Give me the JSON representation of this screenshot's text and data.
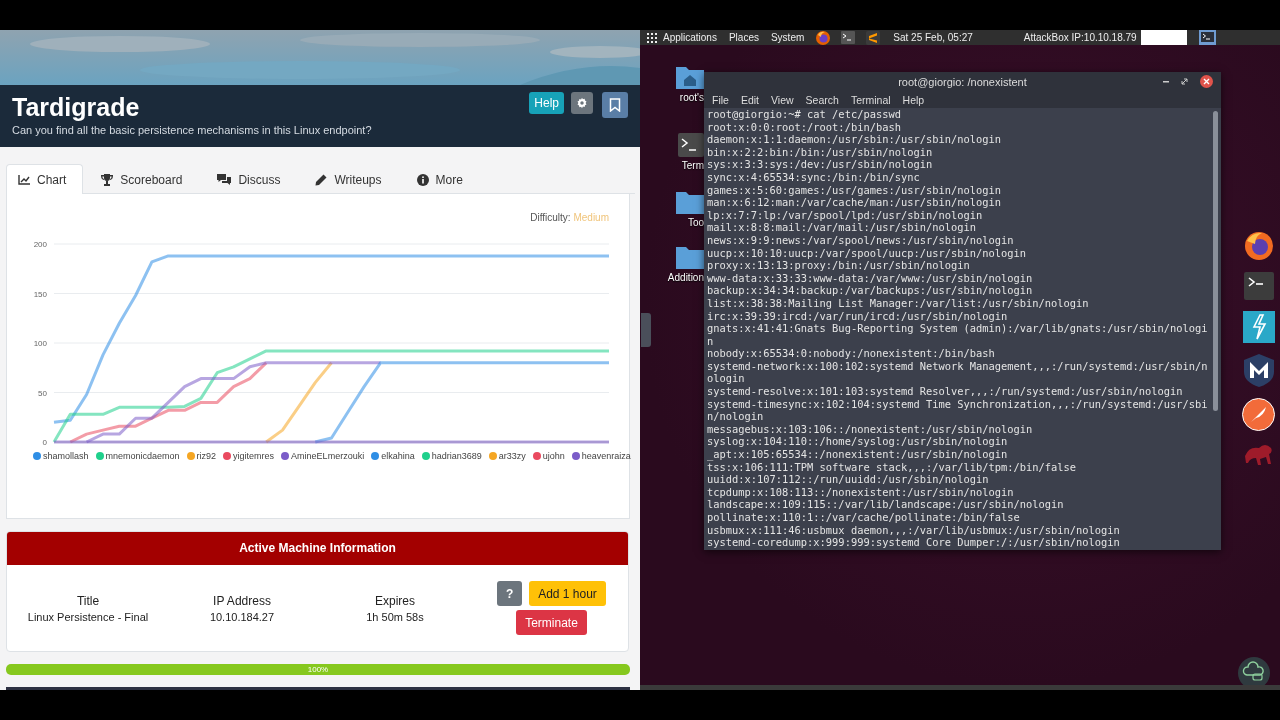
{
  "room": {
    "title": "Tardigrade",
    "description": "Can you find all the basic persistence mechanisms in this Linux endpoint?",
    "buttons": [
      {
        "kind": "help",
        "label": "Help"
      },
      {
        "kind": "settings"
      },
      {
        "kind": "bookmark"
      }
    ]
  },
  "tabs": [
    {
      "label": "Chart",
      "selected": true
    },
    {
      "label": "Scoreboard",
      "selected": false
    },
    {
      "label": "Discuss",
      "selected": false
    },
    {
      "label": "Writeups",
      "selected": false
    },
    {
      "label": "More",
      "selected": false
    }
  ],
  "difficulty": {
    "label": "Difficulty:",
    "value": "Medium"
  },
  "chart_data": {
    "type": "line",
    "grid": true,
    "legend": true,
    "ylim": [
      0,
      200
    ],
    "yticks": [
      0,
      50,
      100,
      150,
      200
    ],
    "series": [
      {
        "name": "shamollash",
        "color": "#2f8ee5",
        "values": [
          20,
          22,
          48,
          88,
          120,
          148,
          182,
          188,
          188,
          188,
          188,
          188,
          188,
          188,
          188,
          188,
          188,
          188,
          188,
          188,
          188,
          188,
          188,
          188,
          188,
          188,
          188,
          188,
          188,
          188,
          188,
          188,
          188,
          188,
          188
        ]
      },
      {
        "name": "mnemonicdaemon",
        "color": "#1fd08c",
        "values": [
          0,
          28,
          28,
          28,
          35,
          35,
          35,
          35,
          36,
          44,
          70,
          76,
          84,
          92,
          92,
          92,
          92,
          92,
          92,
          92,
          92,
          92,
          92,
          92,
          92,
          92,
          92,
          92,
          92,
          92,
          92,
          92,
          92,
          92,
          92
        ]
      },
      {
        "name": "riz92",
        "color": "#f5a623",
        "values": [
          null,
          null,
          null,
          null,
          null,
          null,
          null,
          null,
          null,
          null,
          null,
          null,
          null,
          0,
          12,
          36,
          60,
          80,
          null,
          null,
          null,
          null,
          null,
          null,
          null,
          null,
          null,
          null,
          null,
          null,
          null,
          null,
          null,
          null,
          null
        ]
      },
      {
        "name": "yigitemres",
        "color": "#ea4a5f",
        "values": [
          null,
          0,
          8,
          12,
          16,
          16,
          24,
          32,
          32,
          40,
          40,
          56,
          64,
          80,
          null,
          null,
          null,
          null,
          null,
          null,
          null,
          null,
          null,
          null,
          null,
          null,
          null,
          null,
          null,
          null,
          null,
          null,
          null,
          null,
          null
        ]
      },
      {
        "name": "AmineELmerzouki",
        "color": "#7b5cc8",
        "values": [
          null,
          null,
          0,
          8,
          8,
          24,
          24,
          40,
          56,
          64,
          64,
          64,
          76,
          80,
          80,
          80,
          80,
          80,
          80,
          80,
          80,
          null,
          null,
          null,
          null,
          null,
          null,
          null,
          null,
          null,
          null,
          null,
          null,
          null,
          null
        ]
      },
      {
        "name": "elkahina",
        "color": "#2f8ee5",
        "values": [
          null,
          null,
          null,
          null,
          null,
          null,
          null,
          null,
          null,
          null,
          null,
          null,
          null,
          null,
          null,
          null,
          0,
          4,
          30,
          56,
          80,
          80,
          80,
          80,
          80,
          80,
          80,
          80,
          80,
          80,
          80,
          80,
          80,
          80,
          80
        ]
      },
      {
        "name": "hadrian3689",
        "color": "#1fd08c",
        "values": [
          null,
          null,
          null,
          null,
          null,
          null,
          null,
          null,
          null,
          null,
          null,
          null,
          null,
          null,
          null,
          null,
          null,
          null,
          null,
          null,
          null,
          null,
          null,
          null,
          null,
          null,
          null,
          null,
          null,
          null,
          null,
          null,
          null,
          null,
          null
        ]
      },
      {
        "name": "ar33zy",
        "color": "#f5a623",
        "values": [
          null,
          null,
          null,
          null,
          null,
          null,
          null,
          null,
          null,
          null,
          null,
          null,
          null,
          null,
          null,
          null,
          null,
          null,
          null,
          null,
          null,
          null,
          null,
          null,
          null,
          null,
          null,
          null,
          null,
          null,
          null,
          null,
          null,
          null,
          null
        ]
      },
      {
        "name": "ujohn",
        "color": "#ea4a5f",
        "values": [
          null,
          null,
          null,
          null,
          null,
          null,
          null,
          null,
          null,
          null,
          null,
          null,
          null,
          null,
          null,
          null,
          null,
          null,
          null,
          null,
          null,
          null,
          null,
          null,
          null,
          null,
          null,
          null,
          null,
          null,
          null,
          null,
          null,
          null,
          null
        ]
      },
      {
        "name": "heavenraiza",
        "color": "#7b5cc8",
        "values": [
          0,
          0,
          0,
          0,
          0,
          0,
          0,
          0,
          0,
          0,
          0,
          0,
          0,
          0,
          0,
          0,
          0,
          0,
          0,
          0,
          0,
          0,
          0,
          0,
          0,
          0,
          0,
          0,
          0,
          0,
          0,
          0,
          0,
          0,
          0
        ]
      }
    ]
  },
  "machine": {
    "heading": "Active Machine Information",
    "fields": [
      {
        "label": "Title",
        "value": "Linux Persistence - Final"
      },
      {
        "label": "IP Address",
        "value": "10.10.184.27"
      },
      {
        "label": "Expires",
        "value": "1h 50m 58s"
      }
    ],
    "buttons": [
      {
        "kind": "help",
        "label": "?"
      },
      {
        "kind": "add",
        "label": "Add 1 hour"
      },
      {
        "kind": "terminate",
        "label": "Terminate"
      }
    ]
  },
  "progress": {
    "level": 1,
    "reading": "100%"
  },
  "panel": {
    "menus": [
      "Applications",
      "Places",
      "System"
    ],
    "clock": "Sat 25 Feb, 05:27",
    "address": "AttackBox IP:10.10.18.79"
  },
  "desktop_icons": [
    {
      "kind": "home",
      "label": "root's"
    },
    {
      "kind": "terminal",
      "label": "Term"
    },
    {
      "kind": "folder",
      "label": "Too"
    },
    {
      "kind": "folder",
      "label": "Addition"
    }
  ],
  "terminal": {
    "title": "root@giorgio: /nonexistent",
    "menu": [
      "File",
      "Edit",
      "View",
      "Search",
      "Terminal",
      "Help"
    ],
    "lines": [
      "root@giorgio:~# cat /etc/passwd",
      "root:x:0:0:root:/root:/bin/bash",
      "daemon:x:1:1:daemon:/usr/sbin:/usr/sbin/nologin",
      "bin:x:2:2:bin:/bin:/usr/sbin/nologin",
      "sys:x:3:3:sys:/dev:/usr/sbin/nologin",
      "sync:x:4:65534:sync:/bin:/bin/sync",
      "games:x:5:60:games:/usr/games:/usr/sbin/nologin",
      "man:x:6:12:man:/var/cache/man:/usr/sbin/nologin",
      "lp:x:7:7:lp:/var/spool/lpd:/usr/sbin/nologin",
      "mail:x:8:8:mail:/var/mail:/usr/sbin/nologin",
      "news:x:9:9:news:/var/spool/news:/usr/sbin/nologin",
      "uucp:x:10:10:uucp:/var/spool/uucp:/usr/sbin/nologin",
      "proxy:x:13:13:proxy:/bin:/usr/sbin/nologin",
      "www-data:x:33:33:www-data:/var/www:/usr/sbin/nologin",
      "backup:x:34:34:backup:/var/backups:/usr/sbin/nologin",
      "list:x:38:38:Mailing List Manager:/var/list:/usr/sbin/nologin",
      "irc:x:39:39:ircd:/var/run/ircd:/usr/sbin/nologin",
      "gnats:x:41:41:Gnats Bug-Reporting System (admin):/var/lib/gnats:/usr/sbin/nologin",
      "nobody:x:65534:0:nobody:/nonexistent:/bin/bash",
      "systemd-network:x:100:102:systemd Network Management,,,:/run/systemd:/usr/sbin/nologin",
      "systemd-resolve:x:101:103:systemd Resolver,,,:/run/systemd:/usr/sbin/nologin",
      "systemd-timesync:x:102:104:systemd Time Synchronization,,,:/run/systemd:/usr/sbin/nologin",
      "messagebus:x:103:106::/nonexistent:/usr/sbin/nologin",
      "syslog:x:104:110::/home/syslog:/usr/sbin/nologin",
      "_apt:x:105:65534::/nonexistent:/usr/sbin/nologin",
      "tss:x:106:111:TPM software stack,,,:/var/lib/tpm:/bin/false",
      "uuidd:x:107:112::/run/uuidd:/usr/sbin/nologin",
      "tcpdump:x:108:113::/nonexistent:/usr/sbin/nologin",
      "landscape:x:109:115::/var/lib/landscape:/usr/sbin/nologin",
      "pollinate:x:110:1::/var/cache/pollinate:/bin/false",
      "usbmux:x:111:46:usbmux daemon,,,:/var/lib/usbmux:/usr/sbin/nologin",
      "systemd-coredump:x:999:999:systemd Core Dumper:/:/usr/sbin/nologin"
    ]
  }
}
